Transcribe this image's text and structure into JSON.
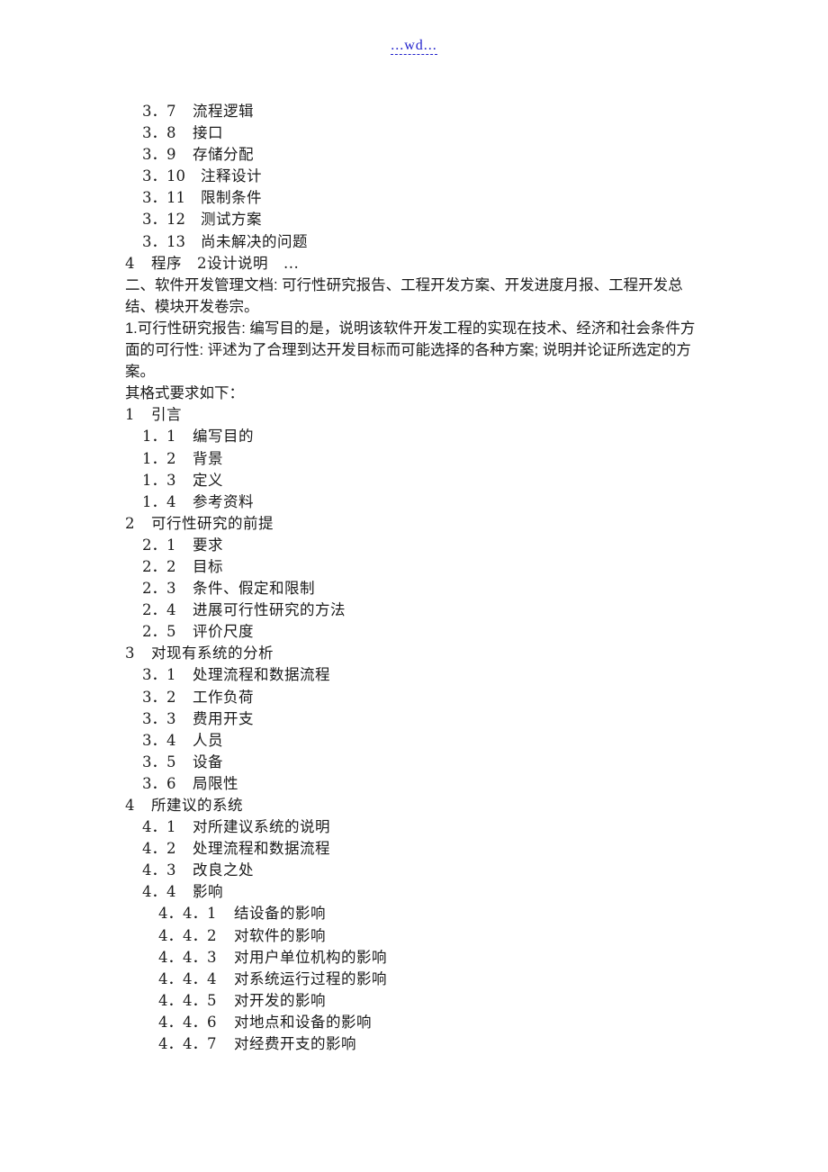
{
  "header": {
    "link_text": "...wd..."
  },
  "toc_top": [
    {
      "num": "3．7",
      "text": "流程逻辑",
      "level": 2
    },
    {
      "num": "3．8",
      "text": "接口",
      "level": 2
    },
    {
      "num": "3．9",
      "text": "存储分配",
      "level": 2
    },
    {
      "num": "3．10",
      "text": "注释设计",
      "level": 2,
      "wide": true
    },
    {
      "num": "3．11",
      "text": "限制条件",
      "level": 2,
      "wide": true
    },
    {
      "num": "3．12",
      "text": "测试方案",
      "level": 2,
      "wide": true
    },
    {
      "num": "3．13",
      "text": "尚未解决的问题",
      "level": 2,
      "wide": true
    },
    {
      "num": "4",
      "text": "程序　2设计说明　...",
      "level": 1
    }
  ],
  "section_heading": "二、软件开发管理文档: 可行性研究报告、工程开发方案、开发进度月报、工程开发总结、模块开发卷宗。",
  "intro_paragraph": "1.可行性研究报告: 编写目的是，说明该软件开发工程的实现在技术、经济和社会条件方面的可行性: 评述为了合理到达开发目标而可能选择的各种方案; 说明并论证所选定的方案。",
  "format_label": "其格式要求如下：",
  "toc_main": [
    {
      "num": "1",
      "text": "引言",
      "level": 1
    },
    {
      "num": "1．1",
      "text": "编写目的",
      "level": 2
    },
    {
      "num": "1．2",
      "text": "背景",
      "level": 2
    },
    {
      "num": "1．3",
      "text": "定义",
      "level": 2
    },
    {
      "num": "1．4",
      "text": "参考资料",
      "level": 2
    },
    {
      "num": "2",
      "text": "可行性研究的前提",
      "level": 1
    },
    {
      "num": "2．1",
      "text": "要求",
      "level": 2
    },
    {
      "num": "2．2",
      "text": "目标",
      "level": 2
    },
    {
      "num": "2．3",
      "text": "条件、假定和限制",
      "level": 2
    },
    {
      "num": "2．4",
      "text": "进展可行性研究的方法",
      "level": 2
    },
    {
      "num": "2．5",
      "text": "评价尺度",
      "level": 2
    },
    {
      "num": "3",
      "text": "对现有系统的分析",
      "level": 1
    },
    {
      "num": "3．1",
      "text": "处理流程和数据流程",
      "level": 2
    },
    {
      "num": "3．2",
      "text": "工作负荷",
      "level": 2
    },
    {
      "num": "3．3",
      "text": "费用开支",
      "level": 2
    },
    {
      "num": "3．4",
      "text": "人员",
      "level": 2
    },
    {
      "num": "3．5",
      "text": "设备",
      "level": 2
    },
    {
      "num": "3．6",
      "text": "局限性",
      "level": 2
    },
    {
      "num": "4",
      "text": "所建议的系统",
      "level": 1
    },
    {
      "num": "4．1",
      "text": "对所建议系统的说明",
      "level": 2
    },
    {
      "num": "4．2",
      "text": "处理流程和数据流程",
      "level": 2
    },
    {
      "num": "4．3",
      "text": "改良之处",
      "level": 2
    },
    {
      "num": "4．4",
      "text": "影响",
      "level": 2
    },
    {
      "num": "4．4．1",
      "text": "结设备的影响",
      "level": 3
    },
    {
      "num": "4．4．2",
      "text": "对软件的影响",
      "level": 3
    },
    {
      "num": "4．4．3",
      "text": "对用户单位机构的影响",
      "level": 3
    },
    {
      "num": "4．4．4",
      "text": "对系统运行过程的影响",
      "level": 3
    },
    {
      "num": "4．4．5",
      "text": "对开发的影响",
      "level": 3
    },
    {
      "num": "4．4．6",
      "text": "对地点和设备的影响",
      "level": 3
    },
    {
      "num": "4．4．7",
      "text": "对经费开支的影响",
      "level": 3
    }
  ]
}
